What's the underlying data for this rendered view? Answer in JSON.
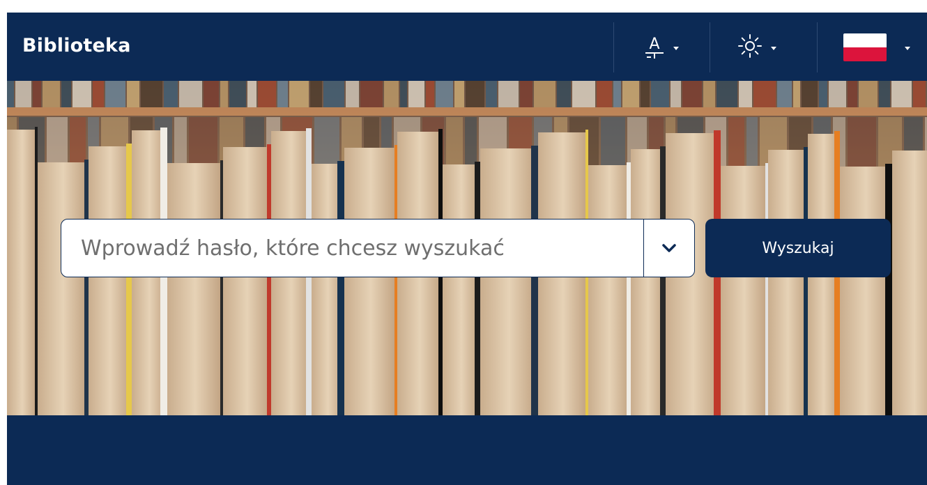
{
  "header": {
    "title": "Biblioteka",
    "font_size_button": {
      "icon": "font-size-icon",
      "glyph": "A"
    },
    "theme_button": {
      "icon": "sun-icon"
    },
    "language_button": {
      "icon": "poland-flag-icon",
      "flag_colors": [
        "#ffffff",
        "#dc143c"
      ]
    }
  },
  "search": {
    "placeholder": "Wprowadź hasło, które chcesz wyszukać",
    "value": "",
    "dropdown_icon": "chevron-down-icon",
    "button_label": "Wyszukaj"
  },
  "colors": {
    "navy": "#0c2a55",
    "white": "#ffffff"
  }
}
